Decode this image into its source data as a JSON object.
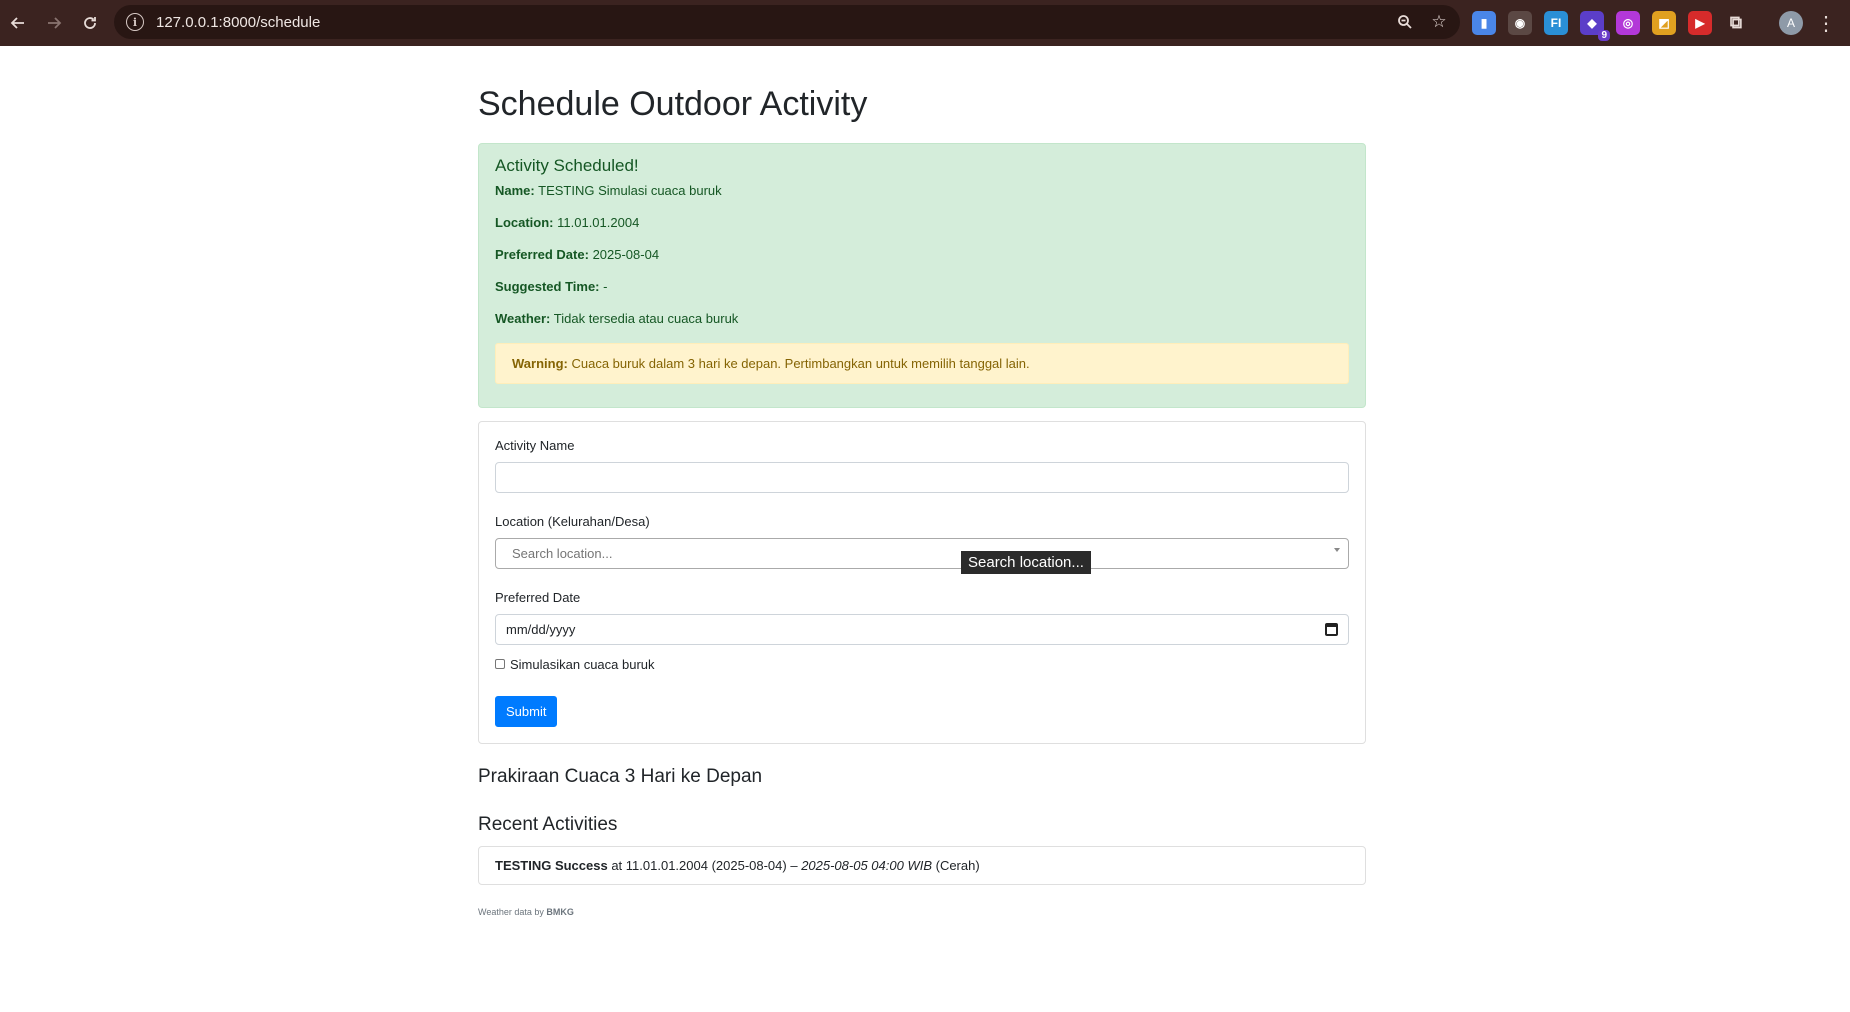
{
  "browser": {
    "url": "127.0.0.1:8000/schedule",
    "extensions": [
      {
        "name": "docs-ext-icon",
        "color": "#4a86e8",
        "glyph": "▮"
      },
      {
        "name": "owl-ext-icon",
        "color": "#5b4844",
        "glyph": "◉"
      },
      {
        "name": "fi-ext-icon",
        "color": "#2a8fd6",
        "glyph": "FI"
      },
      {
        "name": "puzzle-badge-ext-icon",
        "color": "#5b3ec8",
        "glyph": "◆",
        "badge": "9"
      },
      {
        "name": "circle-ext-icon",
        "color": "#b338d8",
        "glyph": "◎"
      },
      {
        "name": "palette-ext-icon",
        "color": "#e0a020",
        "glyph": "◩"
      },
      {
        "name": "youtube-ext-icon",
        "color": "#d62b2b",
        "glyph": "▶"
      }
    ],
    "profile_initial": "A"
  },
  "page": {
    "title": "Schedule Outdoor Activity"
  },
  "result": {
    "heading": "Activity Scheduled!",
    "name_label": "Name:",
    "name_value": "TESTING Simulasi cuaca buruk",
    "location_label": "Location:",
    "location_value": "11.01.01.2004",
    "date_label": "Preferred Date:",
    "date_value": "2025-08-04",
    "time_label": "Suggested Time:",
    "time_value": "-",
    "weather_label": "Weather:",
    "weather_value": "Tidak tersedia atau cuaca buruk",
    "warning_label": "Warning:",
    "warning_text": "Cuaca buruk dalam 3 hari ke depan. Pertimbangkan untuk memilih tanggal lain."
  },
  "form": {
    "activity_name_label": "Activity Name",
    "activity_name_value": "",
    "location_label": "Location (Kelurahan/Desa)",
    "location_placeholder": "Search location...",
    "location_tooltip": "Search location...",
    "date_label": "Preferred Date",
    "date_placeholder": "mm/dd/yyyy",
    "simulate_label": "Simulasikan cuaca buruk",
    "simulate_checked": false,
    "submit_label": "Submit"
  },
  "forecast": {
    "title": "Prakiraan Cuaca 3 Hari ke Depan"
  },
  "recent": {
    "title": "Recent Activities",
    "items": [
      {
        "name": "TESTING Success",
        "detail": " at 11.01.01.2004 (2025-08-04) – ",
        "time": "2025-08-05 04:00 WIB",
        "condition": " (Cerah)"
      }
    ]
  },
  "footer": {
    "prefix": "Weather data by ",
    "source": "BMKG"
  }
}
